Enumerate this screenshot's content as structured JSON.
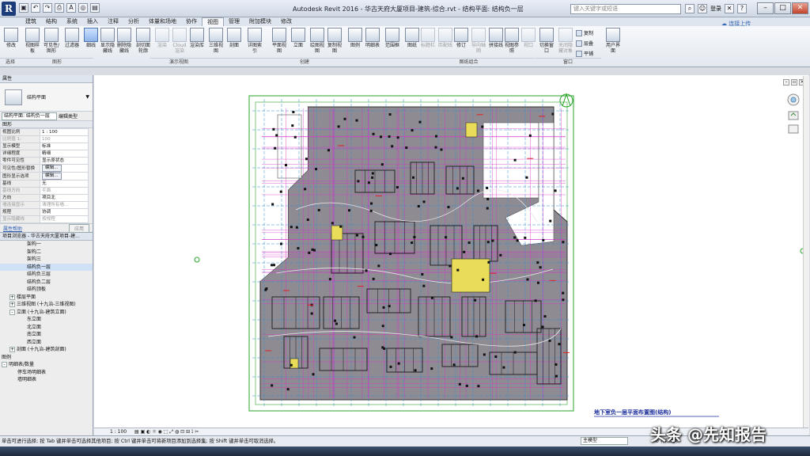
{
  "window": {
    "logo": "R",
    "title": "Autodesk Revit 2016 -   华古天府大厦项目-建筑-综合.rvt - 结构平面: 结构负一层",
    "search_placeholder": "键入关键字或短语",
    "signin": "登录",
    "cloud": "连接上传"
  },
  "qat": [
    "▣",
    "↶",
    "↷",
    "⎙",
    "A",
    "◎",
    "▤"
  ],
  "tabs": [
    "建筑",
    "结构",
    "系统",
    "插入",
    "注释",
    "分析",
    "体量和场地",
    "协作",
    "视图",
    "管理",
    "附加模块",
    "修改"
  ],
  "active_tab": "视图",
  "ribbon": {
    "buttons": [
      {
        "name": "modify-button",
        "label": "修改"
      },
      {
        "name": "view-template-button",
        "label": "视图样板"
      },
      {
        "name": "visibility-button",
        "label": "可见性/图形"
      },
      {
        "name": "filters-button",
        "label": "过滤器"
      },
      {
        "name": "thin-lines-button",
        "label": "细线"
      },
      {
        "name": "show-hidden-button",
        "label": "显示隐藏线"
      },
      {
        "name": "remove-hidden-button",
        "label": "删除隐藏线"
      },
      {
        "name": "cut-profile-button",
        "label": "剖切面轮廓"
      },
      {
        "name": "render-button",
        "label": "渲染"
      },
      {
        "name": "cloud-render-button",
        "label": "Cloud 渲染"
      },
      {
        "name": "render-gallery-button",
        "label": "渲染库"
      },
      {
        "name": "3d-view-button",
        "label": "三维视图"
      },
      {
        "name": "section-button",
        "label": "剖面"
      },
      {
        "name": "callout-button",
        "label": "详图索引"
      },
      {
        "name": "plan-views-button",
        "label": "平面视图"
      },
      {
        "name": "elevation-button",
        "label": "立面"
      },
      {
        "name": "drafting-view-button",
        "label": "绘图视图"
      },
      {
        "name": "duplicate-view-button",
        "label": "复制视图"
      },
      {
        "name": "legends-button",
        "label": "图例"
      },
      {
        "name": "schedules-button",
        "label": "明细表"
      },
      {
        "name": "scope-box-button",
        "label": "范围框"
      },
      {
        "name": "sheet-button",
        "label": "图纸"
      },
      {
        "name": "title-block-button",
        "label": "标题栏"
      },
      {
        "name": "matchline-button",
        "label": "匹配线"
      },
      {
        "name": "revisions-button",
        "label": "修订"
      },
      {
        "name": "guide-grid-button",
        "label": "导向轴网"
      },
      {
        "name": "splice-button",
        "label": "拼接线"
      },
      {
        "name": "view-reference-button",
        "label": "视图参照"
      },
      {
        "name": "viewports-button",
        "label": "视口"
      },
      {
        "name": "switch-windows-button",
        "label": "切换窗口"
      },
      {
        "name": "close-hidden-button",
        "label": "关闭隐藏对象"
      },
      {
        "name": "user-interface-button",
        "label": "用户界面"
      }
    ],
    "small": [
      "复制",
      "层叠",
      "平铺"
    ],
    "groups": [
      "选择",
      "图形",
      "演示视图",
      "创建",
      "图纸组合",
      "窗口"
    ]
  },
  "properties": {
    "panel_title": "属性",
    "type_name": "结构平面",
    "filter_label": "结构平面: 结构负一层",
    "edit_type": "编辑类型",
    "section": "图形",
    "rows": [
      {
        "k": "视图比例",
        "v": "1 : 100"
      },
      {
        "k": "比例值 1:",
        "v": "100"
      },
      {
        "k": "显示模型",
        "v": "标准"
      },
      {
        "k": "详细程度",
        "v": "精细"
      },
      {
        "k": "零件可见性",
        "v": "显示原状态"
      },
      {
        "k": "可见性/图形替换",
        "v": "编辑..."
      },
      {
        "k": "图形显示选项",
        "v": "编辑..."
      },
      {
        "k": "基线",
        "v": "无"
      },
      {
        "k": "基线方向",
        "v": "平面"
      },
      {
        "k": "方向",
        "v": "项目北"
      },
      {
        "k": "墙连接显示",
        "v": "清理所有墙..."
      },
      {
        "k": "规程",
        "v": "协调"
      },
      {
        "k": "显示隐藏线",
        "v": "按规程"
      }
    ],
    "help": "属性帮助",
    "apply": "应用"
  },
  "browser": {
    "title": "项目浏览器 - 华古天府大厦项目-建...",
    "items": [
      {
        "t": "架构一",
        "indent": 34,
        "tog": ""
      },
      {
        "t": "架构二",
        "indent": 34,
        "tog": ""
      },
      {
        "t": "架构三",
        "indent": 34,
        "tog": ""
      },
      {
        "t": "结构负一层",
        "indent": 34,
        "tog": "",
        "sel": true
      },
      {
        "t": "结构负三层",
        "indent": 34,
        "tog": ""
      },
      {
        "t": "结构负二层",
        "indent": 34,
        "tog": ""
      },
      {
        "t": "结构顶板",
        "indent": 34,
        "tog": ""
      },
      {
        "t": "楼层平面",
        "indent": 12,
        "tog": "+"
      },
      {
        "t": "三维视图 (十九治-三维视图)",
        "indent": 12,
        "tog": "+"
      },
      {
        "t": "立面 (十九治-建筑立面)",
        "indent": 12,
        "tog": "-"
      },
      {
        "t": "东立面",
        "indent": 34,
        "tog": ""
      },
      {
        "t": "北立面",
        "indent": 34,
        "tog": ""
      },
      {
        "t": "南立面",
        "indent": 34,
        "tog": ""
      },
      {
        "t": "西立面",
        "indent": 34,
        "tog": ""
      },
      {
        "t": "剖面 (十九治-建筑剖面)",
        "indent": 12,
        "tog": "+"
      },
      {
        "t": "图例",
        "indent": 2,
        "tog": ""
      },
      {
        "t": "明细表/数量",
        "indent": 2,
        "tog": "-"
      },
      {
        "t": "停车场明细表",
        "indent": 22,
        "tog": ""
      },
      {
        "t": "墙明细表",
        "indent": 22,
        "tog": ""
      }
    ]
  },
  "drawing": {
    "title": "地下室负一层平面布置图(结构)"
  },
  "view_bar": {
    "scale": "1 : 100"
  },
  "status": {
    "text": "单击可进行选择; 按 Tab 键并单击可选择其他项目; 按 Ctrl 键并单击可将新项目添加到选择集; 按 Shift 键并单击可取消选择。",
    "model": "主模型",
    "filter": "排除选项"
  },
  "watermark": "头条 @先知报告"
}
